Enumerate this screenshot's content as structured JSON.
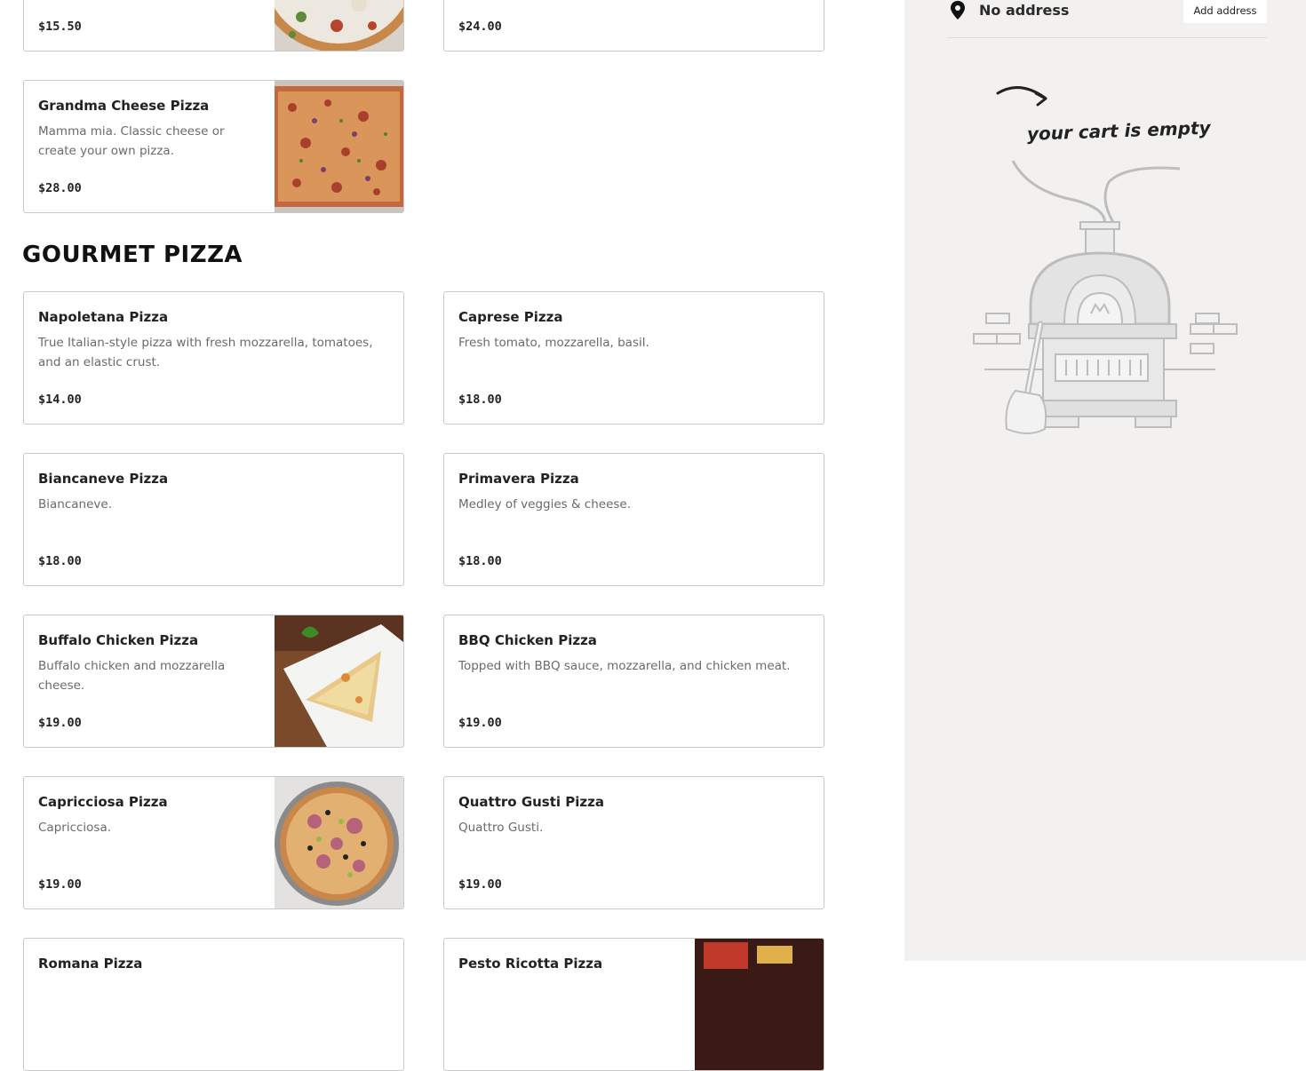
{
  "menu": {
    "top_items": [
      {
        "price": "$15.50"
      },
      {
        "price": "$24.00"
      }
    ],
    "standalone": {
      "name": "Grandma Cheese Pizza",
      "description": "Mamma mia. Classic cheese or create your own pizza.",
      "price": "$28.00"
    },
    "section_title": "GOURMET PIZZA",
    "items": [
      {
        "name": "Napoletana Pizza",
        "description": "True Italian-style pizza with fresh mozzarella, tomatoes, and an elastic crust.",
        "price": "$14.00"
      },
      {
        "name": "Caprese Pizza",
        "description": "Fresh tomato, mozzarella, basil.",
        "price": "$18.00"
      },
      {
        "name": "Biancaneve Pizza",
        "description": "Biancaneve.",
        "price": "$18.00"
      },
      {
        "name": "Primavera Pizza",
        "description": "Medley of veggies & cheese.",
        "price": "$18.00"
      },
      {
        "name": "Buffalo Chicken Pizza",
        "description": "Buffalo chicken and mozzarella cheese.",
        "price": "$19.00"
      },
      {
        "name": "BBQ Chicken Pizza",
        "description": "Topped with BBQ sauce, mozzarella, and chicken meat.",
        "price": "$19.00"
      },
      {
        "name": "Capricciosa Pizza",
        "description": "Capricciosa.",
        "price": "$19.00"
      },
      {
        "name": "Quattro Gusti Pizza",
        "description": "Quattro Gusti.",
        "price": "$19.00"
      },
      {
        "name": "Romana Pizza"
      },
      {
        "name": "Pesto Ricotta Pizza"
      }
    ]
  },
  "cart": {
    "address_text": "No address",
    "add_address_label": "Add address",
    "empty_message": "your cart is empty",
    "pin_icon": "map-pin-icon"
  },
  "colors": {
    "sidebar_bg": "#f2f1ef",
    "card_border": "#c9c9c9",
    "muted_text": "#6a6a6a"
  }
}
